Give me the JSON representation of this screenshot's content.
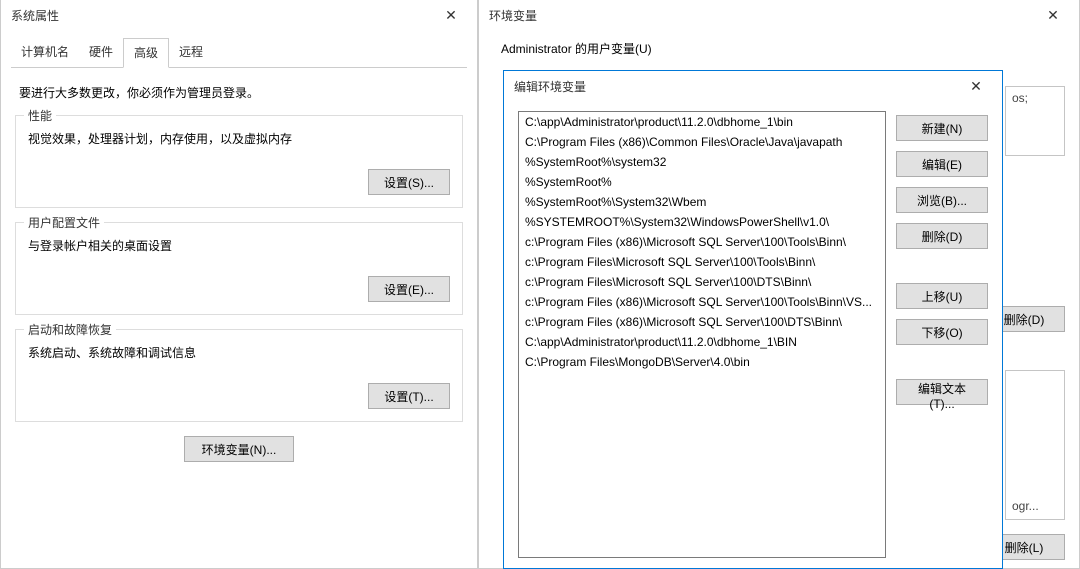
{
  "sysprops": {
    "title": "系统属性",
    "tabs": {
      "computer_name": "计算机名",
      "hardware": "硬件",
      "advanced": "高级",
      "remote": "远程"
    },
    "hint": "要进行大多数更改，你必须作为管理员登录。",
    "performance": {
      "legend": "性能",
      "desc": "视觉效果，处理器计划，内存使用，以及虚拟内存",
      "settings_btn": "设置(S)..."
    },
    "userprofile": {
      "legend": "用户配置文件",
      "desc": "与登录帐户相关的桌面设置",
      "settings_btn": "设置(E)..."
    },
    "startup": {
      "legend": "启动和故障恢复",
      "desc": "系统启动、系统故障和调试信息",
      "settings_btn": "设置(T)..."
    },
    "envvars_btn": "环境变量(N)..."
  },
  "envvars": {
    "title": "环境变量",
    "user_section_label": "Administrator 的用户变量(U)",
    "bg_snippet": "os;",
    "bg_delete_btn": "删除(D)",
    "bg_snippet2": "ogr...",
    "bg_delete_btn2": "删除(L)"
  },
  "editenv": {
    "title": "编辑环境变量",
    "paths": [
      "C:\\app\\Administrator\\product\\11.2.0\\dbhome_1\\bin",
      "C:\\Program Files (x86)\\Common Files\\Oracle\\Java\\javapath",
      "%SystemRoot%\\system32",
      "%SystemRoot%",
      "%SystemRoot%\\System32\\Wbem",
      "%SYSTEMROOT%\\System32\\WindowsPowerShell\\v1.0\\",
      "c:\\Program Files (x86)\\Microsoft SQL Server\\100\\Tools\\Binn\\",
      "c:\\Program Files\\Microsoft SQL Server\\100\\Tools\\Binn\\",
      "c:\\Program Files\\Microsoft SQL Server\\100\\DTS\\Binn\\",
      "c:\\Program Files (x86)\\Microsoft SQL Server\\100\\Tools\\Binn\\VS...",
      "c:\\Program Files (x86)\\Microsoft SQL Server\\100\\DTS\\Binn\\",
      "C:\\app\\Administrator\\product\\11.2.0\\dbhome_1\\BIN"
    ],
    "editing_value": "C:\\Program Files\\MongoDB\\Server\\4.0\\bin",
    "buttons": {
      "new": "新建(N)",
      "edit": "编辑(E)",
      "browse": "浏览(B)...",
      "delete": "删除(D)",
      "move_up": "上移(U)",
      "move_down": "下移(O)",
      "edit_text": "编辑文本(T)..."
    }
  }
}
